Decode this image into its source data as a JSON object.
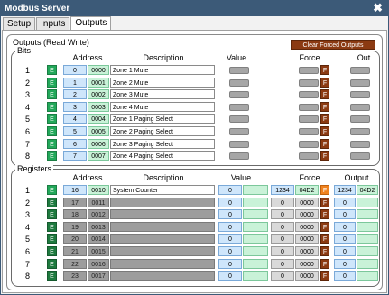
{
  "window": {
    "title": "Modbus Server"
  },
  "tabs": [
    {
      "label": "Setup"
    },
    {
      "label": "Inputs"
    },
    {
      "label": "Outputs"
    }
  ],
  "outputs": {
    "title": "Outputs (Read Write)",
    "clear_button": "Clear Forced Outputs"
  },
  "bits": {
    "title": "Bits",
    "headers": {
      "address": "Address",
      "description": "Description",
      "value": "Value",
      "force": "Force",
      "out": "Out"
    },
    "rows": [
      {
        "num": "1",
        "e": "E",
        "addr": "0",
        "hex": "0000",
        "desc": "Zone 1 Mute",
        "f": "F"
      },
      {
        "num": "2",
        "e": "E",
        "addr": "1",
        "hex": "0001",
        "desc": "Zone 2 Mute",
        "f": "F"
      },
      {
        "num": "3",
        "e": "E",
        "addr": "2",
        "hex": "0002",
        "desc": "Zone 3 Mute",
        "f": "F"
      },
      {
        "num": "4",
        "e": "E",
        "addr": "3",
        "hex": "0003",
        "desc": "Zone 4 Mute",
        "f": "F"
      },
      {
        "num": "5",
        "e": "E",
        "addr": "4",
        "hex": "0004",
        "desc": "Zone 1 Paging Select",
        "f": "F"
      },
      {
        "num": "6",
        "e": "E",
        "addr": "5",
        "hex": "0005",
        "desc": "Zone 2 Paging Select",
        "f": "F"
      },
      {
        "num": "7",
        "e": "E",
        "addr": "6",
        "hex": "0006",
        "desc": "Zone 3 Paging Select",
        "f": "F"
      },
      {
        "num": "8",
        "e": "E",
        "addr": "7",
        "hex": "0007",
        "desc": "Zone 4 Paging Select",
        "f": "F"
      }
    ]
  },
  "registers": {
    "title": "Registers",
    "headers": {
      "address": "Address",
      "description": "Description",
      "value": "Value",
      "force": "Force",
      "output": "Output"
    },
    "rows": [
      {
        "num": "1",
        "e": "E",
        "addr": "16",
        "hex": "0010",
        "desc": "System Counter",
        "val": "0",
        "fdec": "1234",
        "fhex": "04D2",
        "f": "F",
        "odec": "1234",
        "ohex": "04D2"
      },
      {
        "num": "2",
        "e": "E",
        "addr": "17",
        "hex": "0011",
        "desc": "",
        "val": "0",
        "fdec": "0",
        "fhex": "0000",
        "f": "F",
        "odec": "0",
        "ohex": ""
      },
      {
        "num": "3",
        "e": "E",
        "addr": "18",
        "hex": "0012",
        "desc": "",
        "val": "0",
        "fdec": "0",
        "fhex": "0000",
        "f": "F",
        "odec": "0",
        "ohex": ""
      },
      {
        "num": "4",
        "e": "E",
        "addr": "19",
        "hex": "0013",
        "desc": "",
        "val": "0",
        "fdec": "0",
        "fhex": "0000",
        "f": "F",
        "odec": "0",
        "ohex": ""
      },
      {
        "num": "5",
        "e": "E",
        "addr": "20",
        "hex": "0014",
        "desc": "",
        "val": "0",
        "fdec": "0",
        "fhex": "0000",
        "f": "F",
        "odec": "0",
        "ohex": ""
      },
      {
        "num": "6",
        "e": "E",
        "addr": "21",
        "hex": "0015",
        "desc": "",
        "val": "0",
        "fdec": "0",
        "fhex": "0000",
        "f": "F",
        "odec": "0",
        "ohex": ""
      },
      {
        "num": "7",
        "e": "E",
        "addr": "22",
        "hex": "0016",
        "desc": "",
        "val": "0",
        "fdec": "0",
        "fhex": "0000",
        "f": "F",
        "odec": "0",
        "ohex": ""
      },
      {
        "num": "8",
        "e": "E",
        "addr": "23",
        "hex": "0017",
        "desc": "",
        "val": "0",
        "fdec": "0",
        "fhex": "0000",
        "f": "F",
        "odec": "0",
        "ohex": ""
      }
    ]
  },
  "colors": {
    "titlebar": "#3c5a78",
    "enable_green": "#22a85a",
    "force_brown": "#8b3a12",
    "force_orange": "#f0821e"
  },
  "icons": {
    "close": "close-icon"
  }
}
